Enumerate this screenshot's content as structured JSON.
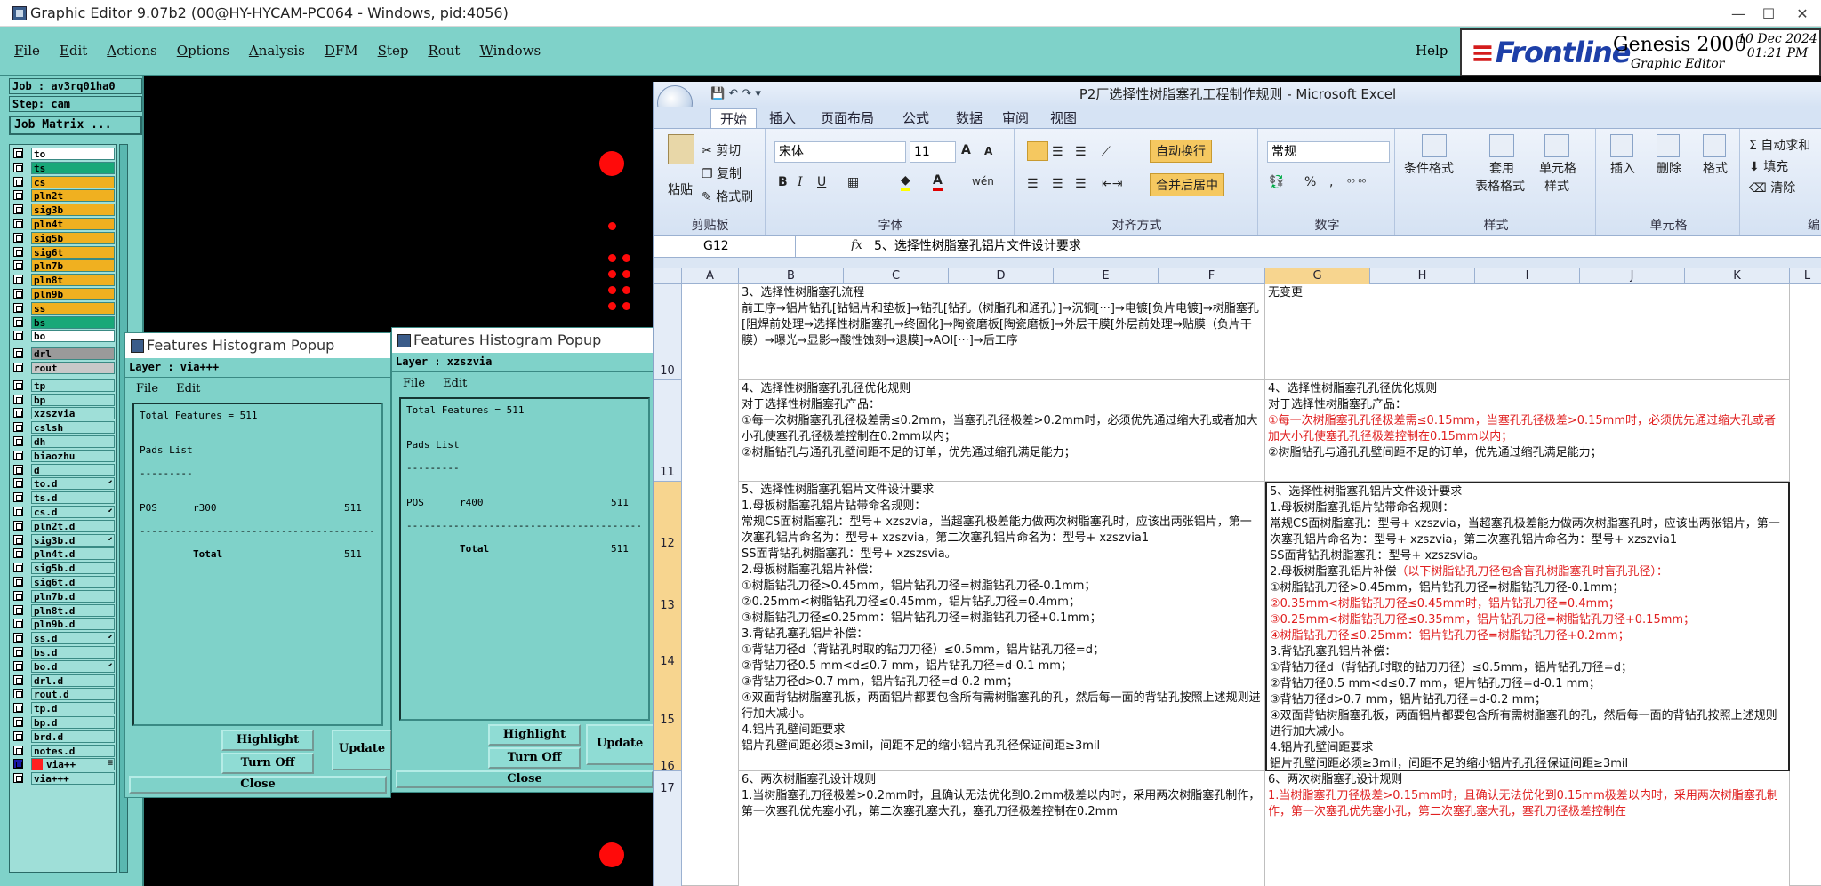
{
  "window": {
    "title": "Graphic Editor 9.07b2 (00@HY-HYCAM-PC064 - Windows, pid:4056)",
    "minimize": "—",
    "maximize": "☐",
    "close": "✕"
  },
  "menu": {
    "items": [
      "File",
      "Edit",
      "Actions",
      "Options",
      "Analysis",
      "DFM",
      "Step",
      "Rout",
      "Windows"
    ],
    "help": "Help"
  },
  "brand": {
    "frontline": "Frontline",
    "product": "Genesis 2000",
    "subtitle": "Graphic Editor",
    "date": "10 Dec 2024",
    "time": "01:21 PM"
  },
  "job": {
    "job_label": "Job : av3rq01ha0",
    "step_label": "Step: cam",
    "matrix_button": "Job Matrix ..."
  },
  "layers": [
    {
      "name": "to",
      "color": "#ffffff",
      "arrow": ""
    },
    {
      "name": "ts",
      "color": "#18a878",
      "arrow": ""
    },
    {
      "name": "cs",
      "color": "#f0b020",
      "arrow": ""
    },
    {
      "name": "pln2t",
      "color": "#f0b020",
      "arrow": ""
    },
    {
      "name": "sig3b",
      "color": "#f0b020",
      "arrow": ""
    },
    {
      "name": "pln4t",
      "color": "#f0b020",
      "arrow": ""
    },
    {
      "name": "sig5b",
      "color": "#f0b020",
      "arrow": ""
    },
    {
      "name": "sig6t",
      "color": "#f0b020",
      "arrow": ""
    },
    {
      "name": "pln7b",
      "color": "#f0b020",
      "arrow": ""
    },
    {
      "name": "pln8t",
      "color": "#f0b020",
      "arrow": ""
    },
    {
      "name": "pln9b",
      "color": "#f0b020",
      "arrow": ""
    },
    {
      "name": "ss",
      "color": "#f0b020",
      "arrow": ""
    },
    {
      "name": "bs",
      "color": "#18a878",
      "arrow": ""
    },
    {
      "name": "bo",
      "color": "#ffffff",
      "arrow": ""
    },
    {
      "name": "drl",
      "color": "#9a9a9a",
      "arrow": ""
    },
    {
      "name": "rout",
      "color": "#c8c8c8",
      "arrow": ""
    },
    {
      "name": "tp",
      "color": "#9fdfd8",
      "arrow": ""
    },
    {
      "name": "bp",
      "color": "#9fdfd8",
      "arrow": ""
    },
    {
      "name": "xzszvia",
      "color": "#9fdfd8",
      "arrow": ""
    },
    {
      "name": "cslsh",
      "color": "#9fdfd8",
      "arrow": ""
    },
    {
      "name": "dh",
      "color": "#9fdfd8",
      "arrow": ""
    },
    {
      "name": "biaozhu",
      "color": "#9fdfd8",
      "arrow": ""
    },
    {
      "name": "d",
      "color": "#9fdfd8",
      "arrow": ""
    },
    {
      "name": "to.d",
      "color": "#9fdfd8",
      "arrow": "⬋"
    },
    {
      "name": "ts.d",
      "color": "#9fdfd8",
      "arrow": ""
    },
    {
      "name": "cs.d",
      "color": "#9fdfd8",
      "arrow": "⬋"
    },
    {
      "name": "pln2t.d",
      "color": "#9fdfd8",
      "arrow": ""
    },
    {
      "name": "sig3b.d",
      "color": "#9fdfd8",
      "arrow": "⬋"
    },
    {
      "name": "pln4t.d",
      "color": "#9fdfd8",
      "arrow": ""
    },
    {
      "name": "sig5b.d",
      "color": "#9fdfd8",
      "arrow": ""
    },
    {
      "name": "sig6t.d",
      "color": "#9fdfd8",
      "arrow": ""
    },
    {
      "name": "pln7b.d",
      "color": "#9fdfd8",
      "arrow": ""
    },
    {
      "name": "pln8t.d",
      "color": "#9fdfd8",
      "arrow": ""
    },
    {
      "name": "pln9b.d",
      "color": "#9fdfd8",
      "arrow": ""
    },
    {
      "name": "ss.d",
      "color": "#9fdfd8",
      "arrow": "⬋"
    },
    {
      "name": "bs.d",
      "color": "#9fdfd8",
      "arrow": ""
    },
    {
      "name": "bo.d",
      "color": "#9fdfd8",
      "arrow": "⬋"
    },
    {
      "name": "drl.d",
      "color": "#9fdfd8",
      "arrow": ""
    },
    {
      "name": "rout.d",
      "color": "#9fdfd8",
      "arrow": ""
    },
    {
      "name": "tp.d",
      "color": "#9fdfd8",
      "arrow": ""
    },
    {
      "name": "bp.d",
      "color": "#9fdfd8",
      "arrow": ""
    },
    {
      "name": "brd.d",
      "color": "#9fdfd8",
      "arrow": ""
    },
    {
      "name": "notes.d",
      "color": "#9fdfd8",
      "arrow": ""
    },
    {
      "name": "via++",
      "color": "#9fdfd8",
      "arrow": "≡"
    },
    {
      "name": "via+++",
      "color": "#9fdfd8",
      "arrow": ""
    }
  ],
  "popup1": {
    "title": "Features Histogram Popup",
    "layer": "Layer :  via+++",
    "menu_file": "File",
    "menu_edit": "Edit",
    "total": "Total Features = 511",
    "list_title": "Pads List",
    "underline": "---------",
    "row_type": "POS",
    "row_sym": "r300",
    "row_count": "511",
    "divider": "---------------------------------------------",
    "total_label": "Total",
    "total_count": "511",
    "highlight": "Highlight",
    "turnoff": "Turn Off",
    "update": "Update",
    "close": "Close"
  },
  "popup2": {
    "title": "Features Histogram Popup",
    "layer": "Layer :  xzszvia",
    "menu_file": "File",
    "menu_edit": "Edit",
    "total": "Total Features = 511",
    "list_title": "Pads List",
    "underline": "---------",
    "row_type": "POS",
    "row_sym": "r400",
    "row_count": "511",
    "divider": "---------------------------------------------",
    "total_label": "Total",
    "total_count": "511",
    "highlight": "Highlight",
    "turnoff": "Turn Off",
    "update": "Update",
    "close": "Close"
  },
  "excel": {
    "title": "P2厂选择性树脂塞孔工程制作规则 - Microsoft Excel",
    "tabs": [
      "开始",
      "插入",
      "页面布局",
      "公式",
      "数据",
      "审阅",
      "视图"
    ],
    "clipboard": {
      "paste": "粘贴",
      "cut": "剪切",
      "copy": "复制",
      "format_painter": "格式刷",
      "group": "剪贴板"
    },
    "font": {
      "name": "宋体",
      "size": "11",
      "bold": "B",
      "italic": "I",
      "underline": "U",
      "grow": "A",
      "shrink": "A",
      "color_letter": "A",
      "phonetic": "wén",
      "group": "字体"
    },
    "align": {
      "wrap": "自动换行",
      "merge": "合并后居中",
      "group": "对齐方式"
    },
    "number": {
      "format": "常规",
      "percent": "%",
      "comma": ",",
      "group": "数字"
    },
    "styles": {
      "conditional": "条件格式",
      "table1": "套用",
      "table2": "表格格式",
      "cell1": "单元格",
      "cell2": "样式",
      "group": "样式"
    },
    "cells": {
      "insert": "插入",
      "delete": "删除",
      "format": "格式",
      "group": "单元格"
    },
    "editing": {
      "autosum": "Σ 自动求和",
      "fill": "填充",
      "clear": "清除",
      "group": "编"
    },
    "namebox": "G12",
    "formula": "5、选择性树脂塞孔铝片文件设计要求",
    "columns": [
      "A",
      "B",
      "C",
      "D",
      "E",
      "F",
      "G",
      "H",
      "I",
      "J",
      "K",
      "L"
    ],
    "rows": [
      "10",
      "11",
      "12",
      "13",
      "14",
      "15",
      "16",
      "17"
    ],
    "b10": "3、选择性树脂塞孔流程\n前工序→铝片钻孔[钻铝片和垫板]→钻孔[钻孔（树脂孔和通孔）]→沉铜[···]→电镀[负片电镀]→树脂塞孔[阻焊前处理→选择性树脂塞孔→终固化]→陶瓷磨板[陶瓷磨板]→外层干膜[外层前处理→贴膜（负片干膜）→曝光→显影→酸性蚀刻→退膜]→AOI[···]→后工序",
    "g10": "无变更",
    "b11": "4、选择性树脂塞孔孔径优化规则\n对于选择性树脂塞孔产品：\n①每一次树脂塞孔孔径极差需≤0.2mm，当塞孔孔径极差>0.2mm时，必须优先通过缩大孔或者加大小孔使塞孔孔径极差控制在0.2mm以内；\n②树脂钻孔与通孔孔壁间距不足的订单，优先通过缩孔满足能力；",
    "g11_a": "4、选择性树脂塞孔孔径优化规则\n对于选择性树脂塞孔产品：",
    "g11_red": "①每一次树脂塞孔孔径极差需≤0.15mm，当塞孔孔径极差>0.15mm时，必须优先通过缩大孔或者加大小孔使塞孔孔径极差控制在0.15mm以内；",
    "g11_b": "②树脂钻孔与通孔孔壁间距不足的订单，优先通过缩孔满足能力；",
    "b12": "5、选择性树脂塞孔铝片文件设计要求\n1.母板树脂塞孔铝片钻带命名规则：\n常规CS面树脂塞孔：型号+ xzszvia，当超塞孔极差能力做两次树脂塞孔时，应该出两张铝片，第一次塞孔铝片命名为：型号+ xzszvia，第二次塞孔铝片命名为：型号+ xzszvia1\nSS面背钻孔树脂塞孔：型号+ xzszsvia。\n2.母板树脂塞孔铝片补偿：\n①树脂钻孔刀径>0.45mm，铝片钻孔刀径=树脂钻孔刀径-0.1mm；\n②0.25mm<树脂钻孔刀径≤0.45mm，铝片钻孔刀径=0.4mm；\n③树脂钻孔刀径≤0.25mm：铝片钻孔刀径=树脂钻孔刀径+0.1mm；\n3.背钻孔塞孔铝片补偿：\n①背钻刀径d（背钻孔时取的钻刀刀径）≤0.5mm，铝片钻孔刀径=d；\n②背钻刀径0.5 mm<d≤0.7 mm，铝片钻孔刀径=d-0.1 mm；\n③背钻刀径d>0.7 mm，铝片钻孔刀径=d-0.2 mm；\n④双面背钻树脂塞孔板，两面铝片都要包含所有需树脂塞孔的孔，然后每一面的背钻孔按照上述规则进行加大减小。\n4.铝片孔壁间距要求\n铝片孔壁间距必须≥3mil，间距不足的缩小铝片孔孔径保证间距≥3mil",
    "g12_a": "5、选择性树脂塞孔铝片文件设计要求\n1.母板树脂塞孔铝片钻带命名规则：\n常规CS面树脂塞孔：型号+ xzszvia，当超塞孔极差能力做两次树脂塞孔时，应该出两张铝片，第一次塞孔铝片命名为：型号+ xzszvia，第二次塞孔铝片命名为：型号+ xzszvia1\nSS面背钻孔树脂塞孔：型号+ xzszsvia。",
    "g12_b1": "2.母板树脂塞孔铝片补偿",
    "g12_b2": "（以下树脂钻孔刀径包含盲孔树脂塞孔时盲孔孔径）：",
    "g12_c": "①树脂钻孔刀径>0.45mm，铝片钻孔刀径=树脂钻孔刀径-0.1mm；",
    "g12_red": "②0.35mm<树脂钻孔刀径≤0.45mm时，铝片钻孔刀径=0.4mm；\n③0.25mm<树脂钻孔刀径≤0.35mm，铝片钻孔刀径=树脂钻孔刀径+0.15mm；\n④树脂钻孔刀径≤0.25mm：铝片钻孔刀径=树脂钻孔刀径+0.2mm；",
    "g12_d": "3.背钻孔塞孔铝片补偿：\n①背钻刀径d（背钻孔时取的钻刀刀径）≤0.5mm，铝片钻孔刀径=d；\n②背钻刀径0.5 mm<d≤0.7 mm，铝片钻孔刀径=d-0.1 mm；\n③背钻刀径d>0.7 mm，铝片钻孔刀径=d-0.2 mm；\n④双面背钻树脂塞孔板，两面铝片都要包含所有需树脂塞孔的孔，然后每一面的背钻孔按照上述规则进行加大减小。\n4.铝片孔壁间距要求\n铝片孔壁间距必须≥3mil，间距不足的缩小铝片孔孔径保证间距≥3mil",
    "b17": "6、两次树脂塞孔设计规则\n1.当树脂塞孔刀径极差>0.2mm时，且确认无法优化到0.2mm极差以内时，采用两次树脂塞孔制作，第一次塞孔优先塞小孔，第二次塞孔塞大孔，塞孔刀径极差控制在0.2mm",
    "g17_a": "6、两次树脂塞孔设计规则",
    "g17_red": "1.当树脂塞孔刀径极差>0.15mm时，且确认无法优化到0.15mm极差以内时，采用两次树脂塞孔制作，第一次塞孔优先塞小孔，第二次塞孔塞大孔，塞孔刀径极差控制在"
  }
}
